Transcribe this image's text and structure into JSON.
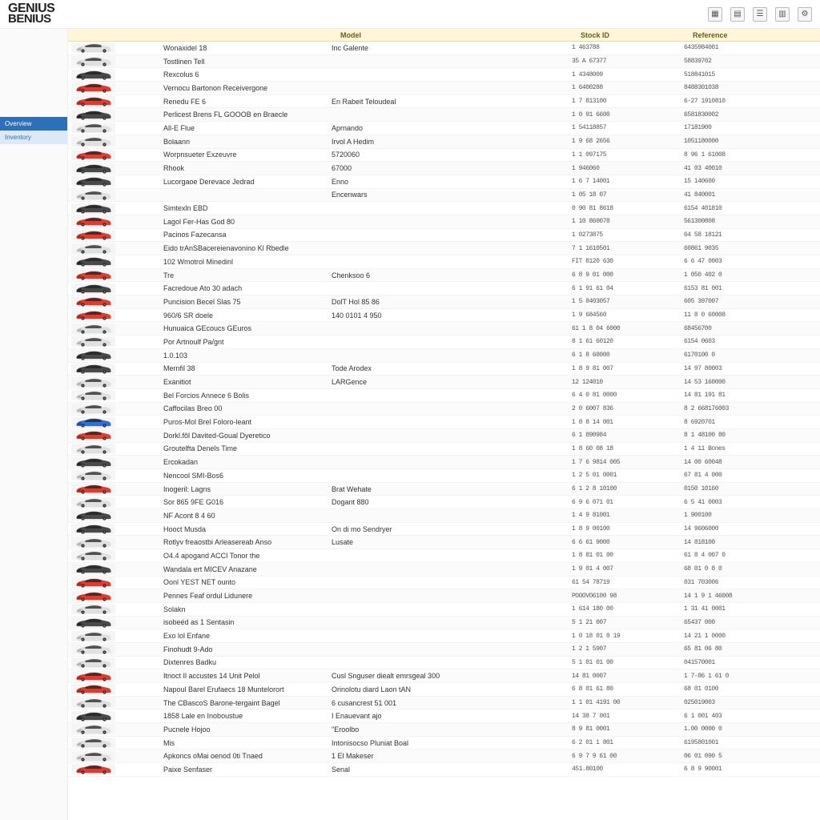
{
  "brand": {
    "line1": "GENIUS",
    "line2": "BENIUS"
  },
  "toolbar": {
    "icons": [
      "grid-icon",
      "layout-icon",
      "list-icon",
      "columns-icon",
      "settings-icon"
    ]
  },
  "sidebar": {
    "items": [
      {
        "label": "Overview",
        "state": "active"
      },
      {
        "label": "Inventory",
        "state": "secondary"
      }
    ]
  },
  "columns": {
    "b": "Model",
    "c": "Stock ID",
    "d": "Reference"
  },
  "car_colors": [
    "silver",
    "silver",
    "black",
    "red",
    "red",
    "black",
    "silver",
    "silver",
    "red",
    "black",
    "black",
    "silver",
    "black",
    "red",
    "red",
    "silver",
    "black",
    "red",
    "black",
    "red",
    "red",
    "silver",
    "silver",
    "black",
    "black",
    "silver",
    "silver",
    "silver",
    "blue",
    "red",
    "silver",
    "black",
    "silver",
    "red",
    "silver",
    "black",
    "black",
    "silver",
    "silver",
    "black",
    "red",
    "red",
    "silver",
    "black",
    "silver",
    "silver",
    "silver",
    "red",
    "red",
    "silver",
    "black",
    "silver",
    "silver",
    "silver",
    "red"
  ],
  "rows": [
    {
      "a": "Wonaxidel 18",
      "b": "Inc Galente",
      "c": "1 463788",
      "d": "6435984001"
    },
    {
      "a": "Tostlinen Tell",
      "b": "",
      "c": "35 A 67377",
      "d": "58839702"
    },
    {
      "a": "Rexcolus 6",
      "b": "",
      "c": "1 4348009",
      "d": "518841015"
    },
    {
      "a": "Vernocu Bartonon Receivergone",
      "b": "",
      "c": "1 6400288",
      "d": "8488301038"
    },
    {
      "a": "Renedu FE 6",
      "b": "En Rabeit Teloudeal",
      "c": "1 7 813100",
      "d": "6-27 1910810"
    },
    {
      "a": "Perlicest Brens FL GOOOB en Braecle",
      "b": "",
      "c": "1 0 91 6600",
      "d": "6581830002"
    },
    {
      "a": "All-E Flue",
      "b": "Aprnando",
      "c": "1 54118857",
      "d": "17181900"
    },
    {
      "a": "Bolaann",
      "b": "Irvol A Hedim",
      "c": "1 9 68 2656",
      "d": "1051180000"
    },
    {
      "a": "Worpnsueter Exzeuvre",
      "b": "5720060",
      "c": "1 1 097175",
      "d": "8 96 1 61008"
    },
    {
      "a": "Rhook",
      "b": "67000",
      "c": "1 946060",
      "d": "41 03 40010"
    },
    {
      "a": "Lucorgaoe Derevace Jedrad",
      "b": "Enno",
      "c": "1 6 7 14001",
      "d": "15 140600"
    },
    {
      "a": "",
      "b": "Encenwars",
      "c": "1 05 18 07",
      "d": "41 840001"
    },
    {
      "a": "Simtexln EBD",
      "b": "",
      "c": "0 90 81 8618",
      "d": "6154 401810"
    },
    {
      "a": "Lagol Fer-Has God 80",
      "b": "",
      "c": "1 10 860078",
      "d": "561300808"
    },
    {
      "a": "Pacinos Fazecansa",
      "b": "",
      "c": "1 0273875",
      "d": "64 58 18121"
    },
    {
      "a": "Eido trAnSBacereienavonino Kl Rbedle",
      "b": "",
      "c": "7 1 1610501",
      "d": "60861 9035"
    },
    {
      "a": "102 Wmotrol Minedinl",
      "b": "",
      "c": "FIT 8120 630",
      "d": "6 6 47 0003"
    },
    {
      "a": "Tre",
      "b": "Chenksoo 6",
      "c": "6 8 9 01 000",
      "d": "1 050 402 0"
    },
    {
      "a": "Facredoue Ato 30 adach",
      "b": "",
      "c": "6 1 91 61 04",
      "d": "6153 81 001"
    },
    {
      "a": "Puncision Becel Slas 75",
      "b": "DolT Hol 85 86",
      "c": "1 5 8403057",
      "d": "605 397007"
    },
    {
      "a": "960/6 SR doele",
      "b": "140 0101 4 950",
      "c": "1 9 684560",
      "d": "11 8 0 60008"
    },
    {
      "a": "Hunuaica GEcoucs GEuros",
      "b": "",
      "c": "61 1 8 04 6000",
      "d": "68456700"
    },
    {
      "a": "Por Artnoulf Pa/gnt",
      "b": "",
      "c": "8 1 61 60120",
      "d": "6154 0603"
    },
    {
      "a": "1.0.103",
      "b": "",
      "c": "6 1 8 60000",
      "d": "6170100 0"
    },
    {
      "a": "Mernfil 38",
      "b": "Tode Arodex",
      "c": "1 8 9 81 007",
      "d": "14 97 80003"
    },
    {
      "a": "Exanitiot",
      "b": "LARGence",
      "c": "12 124010",
      "d": "14 53 160000"
    },
    {
      "a": "Bel Forcios Annece 6 Bolis",
      "b": "",
      "c": "6 4 0 81 0000",
      "d": "14 81 191 81"
    },
    {
      "a": "Caffocilas Breo 00",
      "b": "",
      "c": "2 0 6007 836",
      "d": "8 2 668176003"
    },
    {
      "a": "Puros-Mol Brel Foloro-leant",
      "b": "",
      "c": "1 8 8 14 001",
      "d": "8 6920701"
    },
    {
      "a": "Dorkl.fôl Davited-Goual Dyeretico",
      "b": "",
      "c": "6 1 890984",
      "d": "8 1 48100 80"
    },
    {
      "a": "Groutelfta Denels Time",
      "b": "",
      "c": "1 8 60 08 18",
      "d": "1 4 11 Bones"
    },
    {
      "a": "Ercokadan",
      "b": "",
      "c": "1 7 6 9814 005",
      "d": "14 00 60048"
    },
    {
      "a": "Nencool SMI-Bos6",
      "b": "",
      "c": "1 2 5 01 0001",
      "d": "67 81 4 000"
    },
    {
      "a": "Inogeril: Lagns",
      "b": "Brat Wehate",
      "c": "6 1 2 8 10100",
      "d": "0150 10160"
    },
    {
      "a": "Sor 865 9FE G016",
      "b": "Dogant 880",
      "c": "6 9 6 071 01",
      "d": "6 5 41 0003"
    },
    {
      "a": "NF Acont 8 4 60",
      "b": "",
      "c": "1 4 9 81001",
      "d": "1 900100"
    },
    {
      "a": "Hooct Musda",
      "b": "On di mo Sendryer",
      "c": "1 8 9 00100",
      "d": "14 9606000"
    },
    {
      "a": "Rotlyv freaostbi Arleasereab Anso",
      "b": "Lusate",
      "c": "6 6 61 9000",
      "d": "14 818100"
    },
    {
      "a": "O4.4 apogand ACCI Tonor the",
      "b": "",
      "c": "1 8 81 01 00",
      "d": "61 8 4 007 0"
    },
    {
      "a": "Wandala ert MICEV Anazane",
      "b": "",
      "c": "1 9 01 4 007",
      "d": "68 01 0 8 0"
    },
    {
      "a": "Oonl YEST NET ounto",
      "b": "",
      "c": "61 54 78719",
      "d": "031 703006"
    },
    {
      "a": "Pennes Feaf ordul Lidunere",
      "b": "",
      "c": "POOOVO6100 98",
      "d": "14 1 9 1 46008"
    },
    {
      "a": "Solakn",
      "b": "",
      "c": "1 614 180 00",
      "d": "1 31 41 0001"
    },
    {
      "a": "isobeéd as 1 Sentasin",
      "b": "",
      "c": "5 1 21 007",
      "d": "65437 000"
    },
    {
      "a": "Exo lol Enfane",
      "b": "",
      "c": "1 0 18 01 0 19",
      "d": "14 21 1 0000"
    },
    {
      "a": "Finohudt 9-Ado",
      "b": "",
      "c": "1 2 1 5907",
      "d": "65 81 06 80"
    },
    {
      "a": "Dixtenres Badku",
      "b": "",
      "c": "5 1 81 01 00",
      "d": "041570001"
    },
    {
      "a": "Itnoct Il accustes 14 Unit Pelol",
      "b": "Cusl Snguser diealt emrsgeal 300",
      "c": "14 81 0007",
      "d": "1 7-86 1 61 0"
    },
    {
      "a": "Napoul Barel Erufaecs 18 Muntelorort",
      "b": "Orinolotu diard Laon tAN",
      "c": "6 8 01 61 80",
      "d": "68 01 0100"
    },
    {
      "a": "The CBascoS Barone-tergaint Bagel",
      "b": "6 cusancrest 51 001",
      "c": "1 1 01 4191 00",
      "d": "025019003"
    },
    {
      "a": "1858 Lale en Inoboustue",
      "b": "I Enauevant ajo",
      "c": "14 38 7 001",
      "d": "6 1 001 403"
    },
    {
      "a": "Pucnele Hojoo",
      "b": "\"Eroolbo",
      "c": "8 9 81 0001",
      "d": "1.00 0000 0"
    },
    {
      "a": "Mis",
      "b": "Intonisocso Pluniat Boal",
      "c": "6 2 01 1 801",
      "d": "6195801001"
    },
    {
      "a": "Apkoncs oMai oenod 0ti Tnaed",
      "b": "1 El Makeser",
      "c": "6 9 7 9 61 00",
      "d": "06 01 090 5"
    },
    {
      "a": "Paixe Senfaser",
      "b": "Senal",
      "c": "451.80100",
      "d": "6 8 9 90001"
    }
  ]
}
